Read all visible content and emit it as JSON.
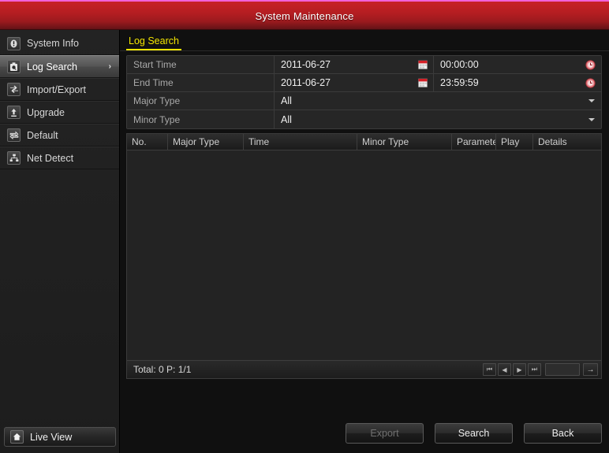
{
  "window": {
    "title": "System Maintenance",
    "accent_color": "#b61e22",
    "top_border_color": "#f261d8"
  },
  "sidebar": {
    "items": [
      {
        "label": "System Info",
        "icon": "info-icon",
        "selected": false,
        "arrow": ""
      },
      {
        "label": "Log Search",
        "icon": "log-search-icon",
        "selected": true,
        "arrow": "›"
      },
      {
        "label": "Import/Export",
        "icon": "import-export-icon",
        "selected": false,
        "arrow": ""
      },
      {
        "label": "Upgrade",
        "icon": "upgrade-icon",
        "selected": false,
        "arrow": ""
      },
      {
        "label": "Default",
        "icon": "default-icon",
        "selected": false,
        "arrow": ""
      },
      {
        "label": "Net Detect",
        "icon": "net-detect-icon",
        "selected": false,
        "arrow": ""
      }
    ],
    "footer": {
      "label": "Live View",
      "icon": "home-icon"
    }
  },
  "content": {
    "tab": {
      "label": "Log Search",
      "active_color": "#f2e400"
    },
    "form": {
      "start_time": {
        "label": "Start Time",
        "date": "2011-06-27",
        "time": "00:00:00",
        "date_icon": "calendar-icon",
        "time_icon": "clock-icon"
      },
      "end_time": {
        "label": "End Time",
        "date": "2011-06-27",
        "time": "23:59:59",
        "date_icon": "calendar-icon",
        "time_icon": "clock-icon"
      },
      "major_type": {
        "label": "Major Type",
        "value": "All",
        "icon": "chevron-down-icon"
      },
      "minor_type": {
        "label": "Minor Type",
        "value": "All",
        "icon": "chevron-down-icon"
      }
    },
    "table": {
      "columns": [
        {
          "label": "No.",
          "width": 52
        },
        {
          "label": "Major Type",
          "width": 96
        },
        {
          "label": "Time",
          "width": 144
        },
        {
          "label": "Minor Type",
          "width": 120
        },
        {
          "label": "Parameter",
          "width": 56
        },
        {
          "label": "Play",
          "width": 47
        },
        {
          "label": "Details",
          "width": 85
        }
      ],
      "rows": [],
      "footer": {
        "total_text": "Total: 0  P: 1/1",
        "page_value": "",
        "page_placeholder": "",
        "buttons": [
          {
            "name": "first-page-button",
            "glyph": "⏮"
          },
          {
            "name": "prev-page-button",
            "glyph": "◀"
          },
          {
            "name": "next-page-button",
            "glyph": "▶"
          },
          {
            "name": "last-page-button",
            "glyph": "⏭"
          }
        ],
        "go_glyph": "→"
      }
    },
    "actions": [
      {
        "label": "Export",
        "name": "export-button",
        "disabled": true
      },
      {
        "label": "Search",
        "name": "search-button",
        "disabled": false
      },
      {
        "label": "Back",
        "name": "back-button",
        "disabled": false
      }
    ]
  }
}
